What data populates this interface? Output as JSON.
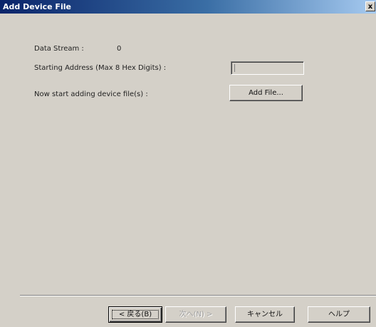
{
  "window": {
    "title": "Add Device File",
    "close_glyph": "x"
  },
  "form": {
    "data_stream_label": "Data Stream :",
    "data_stream_value": "0",
    "starting_address_label": "Starting Address (Max 8 Hex Digits) :",
    "starting_address_value": "",
    "add_files_label": "Now start adding device file(s) :",
    "add_file_button": "Add File..."
  },
  "footer": {
    "back_button": "< 戻る(B)",
    "next_button": "次へ(N) >",
    "cancel_button": "キャンセル",
    "help_button": "ヘルプ"
  },
  "icons": {
    "close": "close-icon"
  },
  "colors": {
    "titlebar_start": "#0a246a",
    "titlebar_end": "#a6caf0",
    "dialog_bg": "#d4d0c8"
  }
}
